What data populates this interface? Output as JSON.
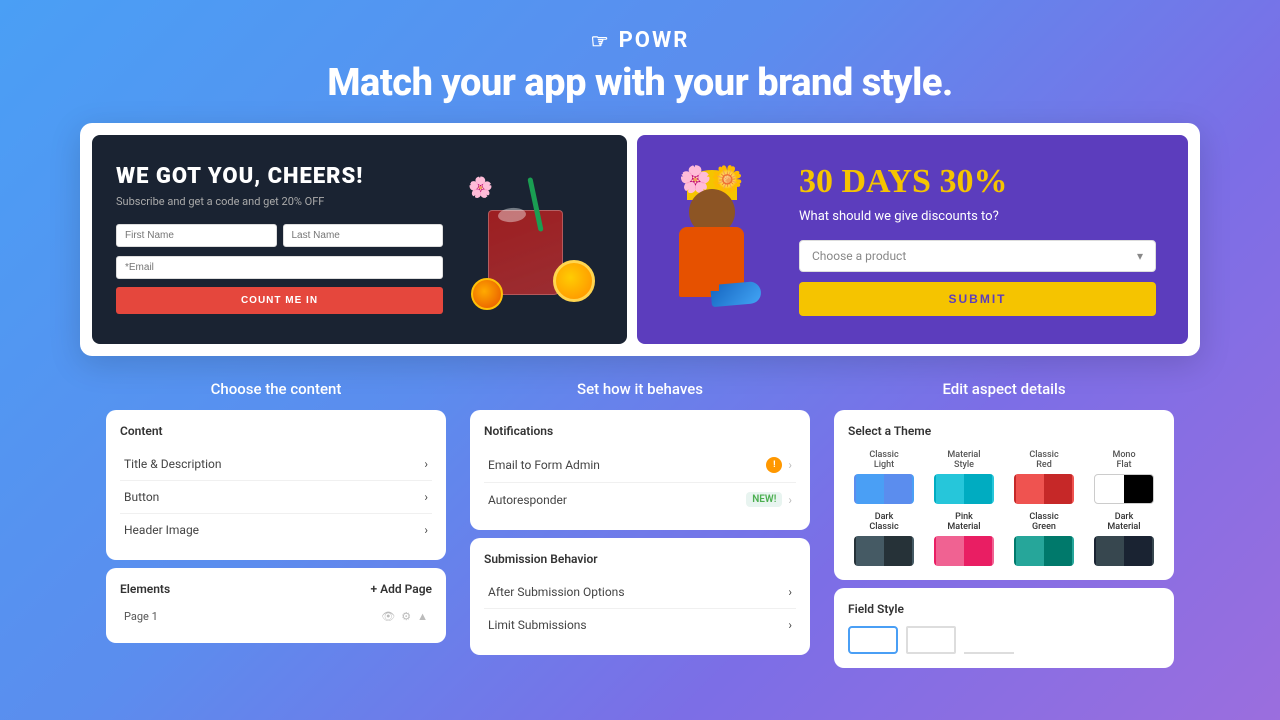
{
  "header": {
    "logo": "POWR",
    "headline": "Match your app with your brand style."
  },
  "preview": {
    "card_dark": {
      "title": "WE GOT YOU, CHEERS!",
      "subtitle": "Subscribe and get a code and get 20% OFF",
      "field_first": "First Name",
      "field_last": "Last Name",
      "field_email": "*Email",
      "button": "COUNT ME IN"
    },
    "card_purple": {
      "title": "30 DAYS 30%",
      "question": "What should we give discounts to?",
      "dropdown_placeholder": "Choose a product",
      "submit_button": "SUBMIT"
    }
  },
  "sections": {
    "content": {
      "title": "Choose the content",
      "panel_header": "Content",
      "items": [
        "Title & Description",
        "Button",
        "Header Image"
      ],
      "elements_header": "Elements",
      "add_page": "+ Add Page",
      "page_item": "Page 1"
    },
    "behavior": {
      "title": "Set how it behaves",
      "notifications_header": "Notifications",
      "notifications": [
        {
          "label": "Email to Form Admin",
          "badge": "warn"
        },
        {
          "label": "Autoresponder",
          "badge": "new",
          "badge_text": "NEW!"
        }
      ],
      "submission_header": "Submission Behavior",
      "submission_items": [
        "After Submission Options",
        "Limit Submissions"
      ]
    },
    "design": {
      "title": "Edit aspect details",
      "theme_header": "Select a Theme",
      "themes": [
        {
          "name": "Classic Light",
          "key": "classic-light",
          "active": false
        },
        {
          "name": "Material Style",
          "key": "material-style",
          "active": false
        },
        {
          "name": "Classic Red",
          "key": "classic-red",
          "active": false
        },
        {
          "name": "Mono Flat",
          "key": "mono-flat",
          "active": true
        },
        {
          "name": "Dark Classic",
          "key": "dark-classic",
          "active": false
        },
        {
          "name": "Pink Material",
          "key": "pink-material",
          "active": false
        },
        {
          "name": "Classic Green",
          "key": "classic-green",
          "active": false
        },
        {
          "name": "Dark Material",
          "key": "dark-material",
          "active": false
        }
      ],
      "field_style_header": "Field Style"
    }
  }
}
